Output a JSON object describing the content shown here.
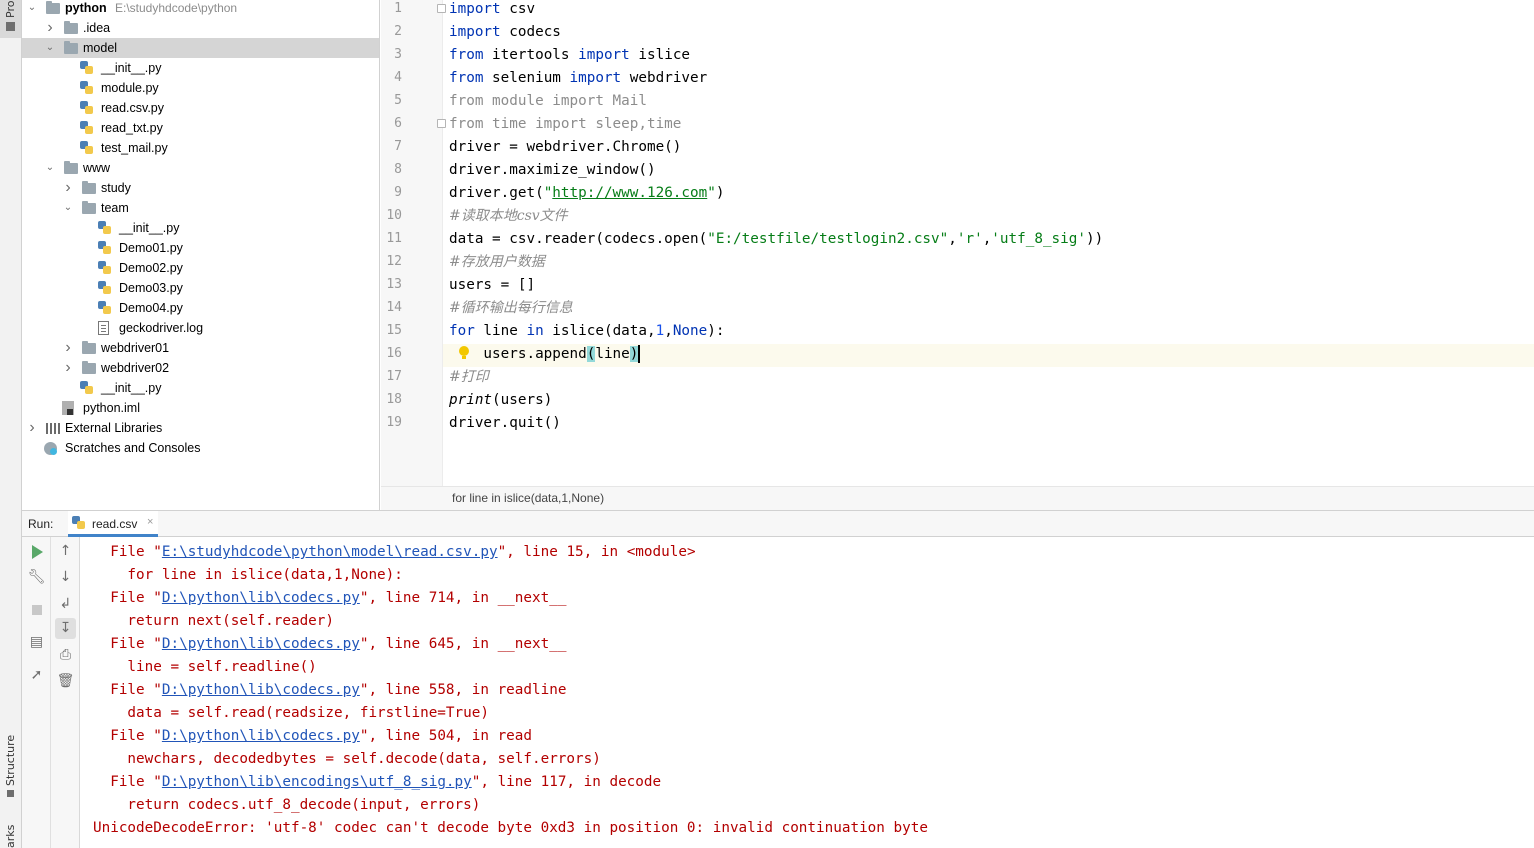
{
  "left_strip": {
    "project_tab": "Pro",
    "structure_tab": "Structure",
    "bookmarks_tab": "arks"
  },
  "project_tree": [
    {
      "label": "python",
      "path": "E:\\studyhdcode\\python",
      "icon": "folder-icon",
      "expanded": true,
      "bold": true
    },
    {
      "label": ".idea",
      "icon": "folder-icon",
      "expanded": false
    },
    {
      "label": "model",
      "icon": "folder-icon",
      "expanded": true,
      "selected": true
    },
    {
      "label": "__init__.py",
      "icon": "python-file-icon"
    },
    {
      "label": "module.py",
      "icon": "python-file-icon"
    },
    {
      "label": "read.csv.py",
      "icon": "python-file-icon"
    },
    {
      "label": "read_txt.py",
      "icon": "python-file-icon"
    },
    {
      "label": "test_mail.py",
      "icon": "python-file-icon"
    },
    {
      "label": "www",
      "icon": "folder-icon",
      "expanded": true
    },
    {
      "label": "study",
      "icon": "folder-icon",
      "expanded": false
    },
    {
      "label": "team",
      "icon": "folder-icon",
      "expanded": true
    },
    {
      "label": "__init__.py",
      "icon": "python-file-icon"
    },
    {
      "label": "Demo01.py",
      "icon": "python-file-icon"
    },
    {
      "label": "Demo02.py",
      "icon": "python-file-icon"
    },
    {
      "label": "Demo03.py",
      "icon": "python-file-icon"
    },
    {
      "label": "Demo04.py",
      "icon": "python-file-icon"
    },
    {
      "label": "geckodriver.log",
      "icon": "log-file-icon"
    },
    {
      "label": "webdriver01",
      "icon": "folder-icon",
      "expanded": false
    },
    {
      "label": "webdriver02",
      "icon": "folder-icon",
      "expanded": false
    },
    {
      "label": "__init__.py",
      "icon": "python-file-icon"
    },
    {
      "label": "python.iml",
      "icon": "iml-file-icon"
    },
    {
      "label": "External Libraries",
      "icon": "libraries-icon",
      "expanded": false
    },
    {
      "label": "Scratches and Consoles",
      "icon": "scratches-icon"
    }
  ],
  "editor": {
    "line_numbers": [
      "1",
      "2",
      "3",
      "4",
      "5",
      "6",
      "7",
      "8",
      "9",
      "10",
      "11",
      "12",
      "13",
      "14",
      "15",
      "16",
      "17",
      "18",
      "19"
    ],
    "current_line": 16,
    "breadcrumb": "for line in islice(data,1,None)",
    "lines": [
      [
        {
          "t": "import",
          "c": "kw"
        },
        {
          "t": " csv"
        }
      ],
      [
        {
          "t": "import",
          "c": "kw"
        },
        {
          "t": " codecs"
        }
      ],
      [
        {
          "t": "from",
          "c": "kw"
        },
        {
          "t": " itertools "
        },
        {
          "t": "import",
          "c": "kw"
        },
        {
          "t": " islice"
        }
      ],
      [
        {
          "t": "from",
          "c": "kw"
        },
        {
          "t": " selenium "
        },
        {
          "t": "import",
          "c": "kw"
        },
        {
          "t": " webdriver"
        }
      ],
      [
        {
          "t": "from module import Mail",
          "c": "dim"
        }
      ],
      [
        {
          "t": "from time import sleep,time",
          "c": "dim"
        }
      ],
      [
        {
          "t": "driver = webdriver.Chrome()"
        }
      ],
      [
        {
          "t": "driver.maximize_window()"
        }
      ],
      [
        {
          "t": "driver.get("
        },
        {
          "t": "\"",
          "c": "str"
        },
        {
          "t": "http://www.126.com",
          "c": "url"
        },
        {
          "t": "\"",
          "c": "str"
        },
        {
          "t": ")"
        }
      ],
      [
        {
          "t": "#读取本地csv文件",
          "c": "cmt"
        }
      ],
      [
        {
          "t": "data = csv.reader(codecs.open("
        },
        {
          "t": "\"E:/testfile/testlogin2.csv\"",
          "c": "str"
        },
        {
          "t": ","
        },
        {
          "t": "'r'",
          "c": "str"
        },
        {
          "t": ","
        },
        {
          "t": "'utf_8_sig'",
          "c": "str"
        },
        {
          "t": "))"
        }
      ],
      [
        {
          "t": "#存放用户数据",
          "c": "cmt"
        }
      ],
      [
        {
          "t": "users = []"
        }
      ],
      [
        {
          "t": "#循环输出每行信息",
          "c": "cmt"
        }
      ],
      [
        {
          "t": "for",
          "c": "kw"
        },
        {
          "t": " line "
        },
        {
          "t": "in",
          "c": "kw"
        },
        {
          "t": " islice(data,"
        },
        {
          "t": "1",
          "c": "num"
        },
        {
          "t": ","
        },
        {
          "t": "None",
          "c": "kw"
        },
        {
          "t": "):"
        }
      ],
      [
        {
          "t": "    users.append"
        },
        {
          "t": "(",
          "c": "brace"
        },
        {
          "t": "line"
        },
        {
          "t": ")",
          "c": "brace"
        },
        {
          "t": "",
          "c": "caret"
        }
      ],
      [
        {
          "t": "#打印",
          "c": "cmt"
        }
      ],
      [
        {
          "t": "print",
          "c": "call"
        },
        {
          "t": "(users)"
        }
      ],
      [
        {
          "t": "driver.quit()"
        }
      ]
    ]
  },
  "run_window": {
    "label": "Run:",
    "tab_label": "read.csv",
    "tab_close": "×"
  },
  "console": [
    [
      {
        "t": "  File \""
      },
      {
        "t": "E:\\studyhdcode\\python\\model\\read.csv.py",
        "c": "link"
      },
      {
        "t": "\", line 15, in <module>"
      }
    ],
    [
      {
        "t": "    for line in islice(data,1,None):"
      }
    ],
    [
      {
        "t": "  File \""
      },
      {
        "t": "D:\\python\\lib\\codecs.py",
        "c": "link"
      },
      {
        "t": "\", line 714, in __next__"
      }
    ],
    [
      {
        "t": "    return next(self.reader)"
      }
    ],
    [
      {
        "t": "  File \""
      },
      {
        "t": "D:\\python\\lib\\codecs.py",
        "c": "link"
      },
      {
        "t": "\", line 645, in __next__"
      }
    ],
    [
      {
        "t": "    line = self.readline()"
      }
    ],
    [
      {
        "t": "  File \""
      },
      {
        "t": "D:\\python\\lib\\codecs.py",
        "c": "link"
      },
      {
        "t": "\", line 558, in readline"
      }
    ],
    [
      {
        "t": "    data = self.read(readsize, firstline=True)"
      }
    ],
    [
      {
        "t": "  File \""
      },
      {
        "t": "D:\\python\\lib\\codecs.py",
        "c": "link"
      },
      {
        "t": "\", line 504, in read"
      }
    ],
    [
      {
        "t": "    newchars, decodedbytes = self.decode(data, self.errors)"
      }
    ],
    [
      {
        "t": "  File \""
      },
      {
        "t": "D:\\python\\lib\\encodings\\utf_8_sig.py",
        "c": "link"
      },
      {
        "t": "\", line 117, in decode"
      }
    ],
    [
      {
        "t": "    return codecs.utf_8_decode(input, errors)"
      }
    ],
    [
      {
        "t": "UnicodeDecodeError: 'utf-8' codec can't decode byte 0xd3 in position 0: invalid continuation byte"
      }
    ]
  ],
  "colors": {
    "keyword": "#0033b3",
    "string": "#067d17",
    "number": "#1750eb",
    "comment": "#8c8c8c",
    "error_text": "#b30000",
    "link": "#2155b8",
    "selection": "#d5d5d5",
    "current_line": "#fcfaed"
  }
}
